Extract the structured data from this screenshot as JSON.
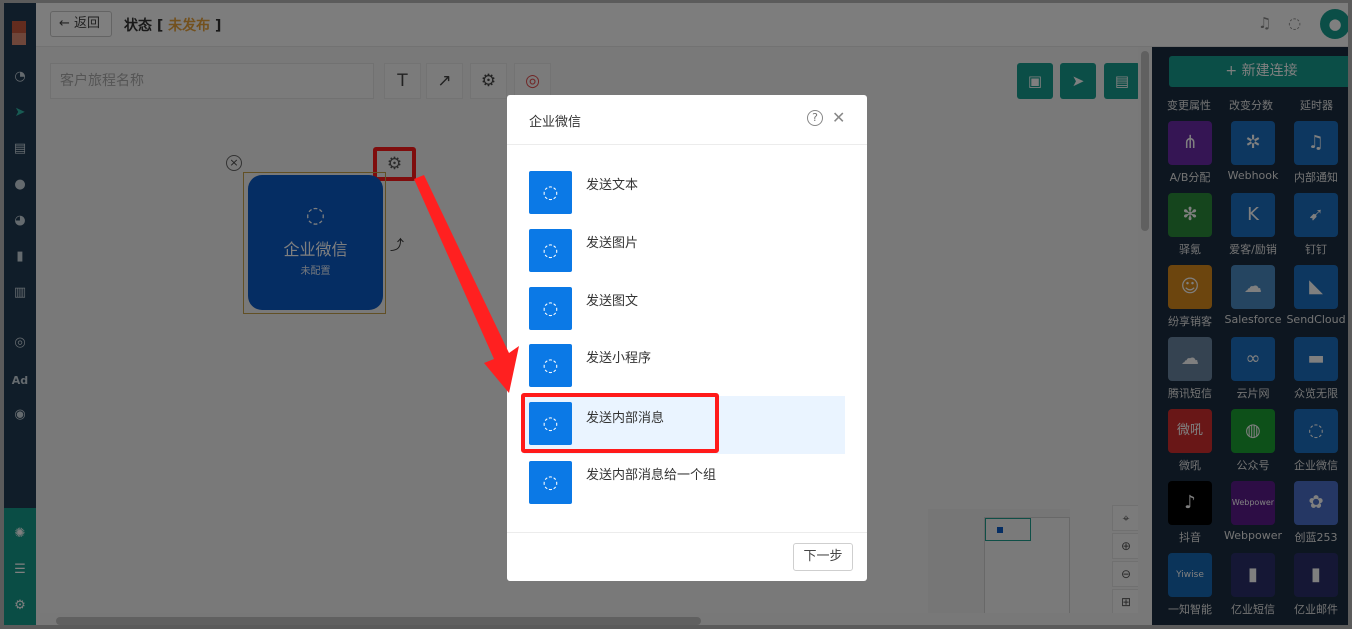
{
  "topbar": {
    "back_label": "返回",
    "status_prefix": "状态 [",
    "status_value": "未发布",
    "status_suffix": "]"
  },
  "canvas": {
    "journey_name_placeholder": "客户旅程名称",
    "node": {
      "title": "企业微信",
      "subtitle": "未配置"
    }
  },
  "panel": {
    "new_connection_label": "+ 新建连接",
    "top_labels": [
      "变更属性",
      "改变分数",
      "延时器"
    ],
    "connectors": [
      [
        "A/B分配",
        "Webhook",
        "内部通知"
      ],
      [
        "驿氪",
        "爱客/励销",
        "钉钉"
      ],
      [
        "纷享销客",
        "Salesforce",
        "SendCloud"
      ],
      [
        "腾讯短信",
        "云片网",
        "众览无限"
      ],
      [
        "微吼",
        "公众号",
        "企业微信"
      ],
      [
        "抖音",
        "Webpower",
        "创蓝253"
      ],
      [
        "一知智能",
        "亿业短信",
        "亿业邮件"
      ]
    ],
    "tile_texts": {
      "weihou": "微吼",
      "webpower": "Webpower",
      "ywise": "Yiwise"
    }
  },
  "dialog": {
    "title": "企业微信",
    "options": [
      "发送文本",
      "发送图片",
      "发送图文",
      "发送小程序",
      "发送内部消息",
      "发送内部消息给一个组"
    ],
    "selected_index": 4,
    "next_label": "下一步"
  }
}
